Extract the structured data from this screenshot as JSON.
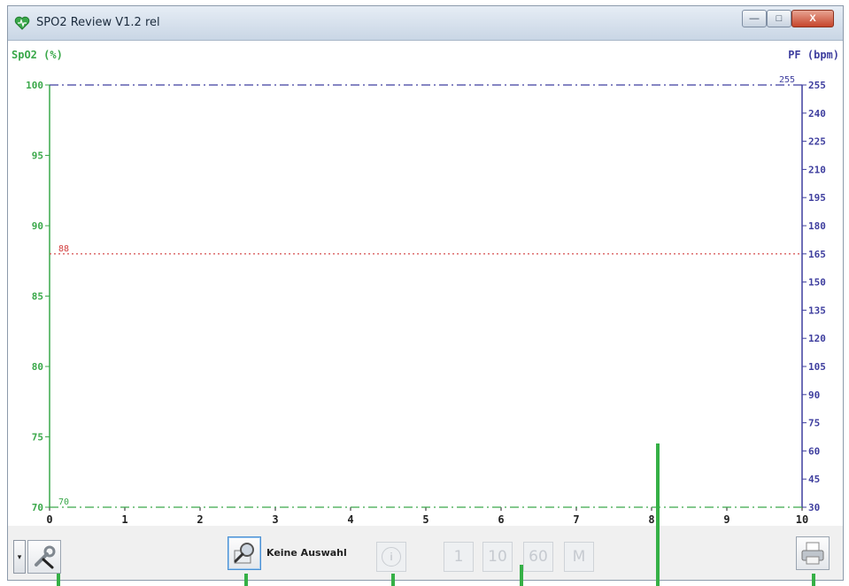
{
  "window": {
    "title": "SPO2 Review V1.2 rel",
    "min_glyph": "—",
    "max_glyph": "□",
    "close_glyph": "X"
  },
  "chart_data": {
    "type": "line",
    "title": "",
    "xlabel": "",
    "x_ticks": [
      "0",
      "1",
      "2",
      "3",
      "4",
      "5",
      "6",
      "7",
      "8",
      "9",
      "10"
    ],
    "x_range": [
      0,
      10
    ],
    "left_axis": {
      "label": "SpO2 (%)",
      "range": [
        70,
        100
      ],
      "ticks": [
        "70",
        "75",
        "80",
        "85",
        "90",
        "95",
        "100"
      ],
      "color": "#3aa84a"
    },
    "right_axis": {
      "label": "PF (bpm)",
      "range": [
        30,
        255
      ],
      "ticks": [
        "30",
        "45",
        "60",
        "75",
        "90",
        "105",
        "120",
        "135",
        "150",
        "165",
        "180",
        "195",
        "210",
        "225",
        "240",
        "255"
      ],
      "color": "#3f3f9f"
    },
    "reference_lines": [
      {
        "label": "88",
        "value": 88,
        "axis": "left",
        "color": "#d23c3c",
        "style": "dotted"
      },
      {
        "label": "70",
        "value": 70,
        "axis": "left",
        "color": "#3aa84a",
        "style": "dash-dot"
      },
      {
        "label": "255",
        "value": 255,
        "axis": "right",
        "color": "#3f3f9f",
        "style": "dash-dot"
      }
    ],
    "series": []
  },
  "toolbar": {
    "selection_text": "Keine Auswahl",
    "dropdown_glyph": "▾",
    "scale_buttons": [
      "1",
      "10",
      "60",
      "M"
    ],
    "info_glyph": "i"
  },
  "colors": {
    "callout": "#35b046",
    "heart": "#3aa84a"
  }
}
